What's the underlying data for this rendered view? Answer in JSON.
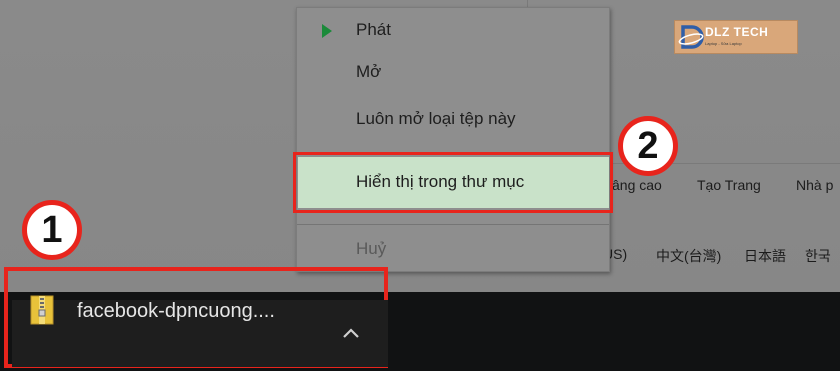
{
  "page": {
    "links": [
      "âng cao",
      "Tạo Trang",
      "Nhà p"
    ],
    "languages": [
      "US)",
      "中文(台灣)",
      "日本語",
      "한국"
    ]
  },
  "watermark": {
    "brand": "DLZ TECH",
    "tagline": "Laptop - Sửa Laptop",
    "icon": "dlz-logo-icon"
  },
  "context_menu": {
    "items": [
      {
        "label": "Phát",
        "icon": "play-icon",
        "enabled": true
      },
      {
        "label": "Mở",
        "enabled": true
      },
      {
        "label": "Luôn mở loại tệp này",
        "enabled": true
      },
      {
        "label": "Hiển thị trong thư mục",
        "enabled": true,
        "highlighted": true
      },
      {
        "label": "Huỷ",
        "enabled": false
      }
    ]
  },
  "annotations": {
    "step1": "1",
    "step2": "2",
    "color": "#e8241c"
  },
  "download_shelf": {
    "file_name": "facebook-dpncuong....",
    "file_icon": "zip-file-icon",
    "menu_icon": "chevron-up-icon"
  },
  "colors": {
    "highlight_fill": "#c9e2c9",
    "play_icon": "#1b8a3a",
    "shelf_bg": "#111213"
  }
}
